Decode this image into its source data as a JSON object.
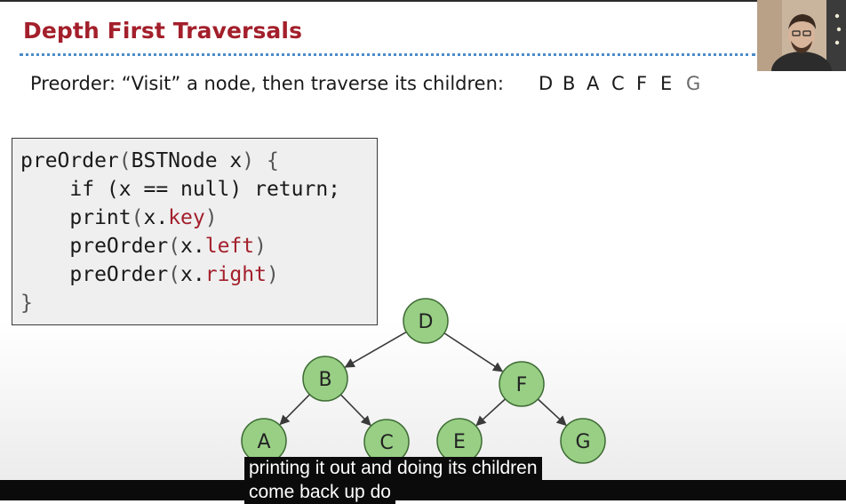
{
  "slide": {
    "title": "Depth First Traversals",
    "preorder_text": "Preorder: “Visit” a node, then traverse its children:",
    "sequence": [
      "D",
      "B",
      "A",
      "C",
      "F",
      "E",
      "G"
    ]
  },
  "code": {
    "line1": {
      "name": "preOrder",
      "open": "(",
      "arg": "BSTNode x",
      "close": ")",
      "brace": " {"
    },
    "line2": "if (x == null) return;",
    "line3": {
      "fn": "print",
      "open": "(",
      "obj": "x.",
      "field": "key",
      "close": ")"
    },
    "line4": {
      "fn": "preOrder",
      "open": "(",
      "obj": "x.",
      "field": "left",
      "close": ")"
    },
    "line5": {
      "fn": "preOrder",
      "open": "(",
      "obj": "x.",
      "field": "right",
      "close": ")"
    },
    "line6": "}"
  },
  "tree": {
    "nodes": [
      {
        "id": "D",
        "label": "D"
      },
      {
        "id": "B",
        "label": "B"
      },
      {
        "id": "F",
        "label": "F"
      },
      {
        "id": "A",
        "label": "A"
      },
      {
        "id": "C",
        "label": "C"
      },
      {
        "id": "E",
        "label": "E"
      },
      {
        "id": "G",
        "label": "G"
      }
    ],
    "edges": [
      [
        "D",
        "B"
      ],
      [
        "D",
        "F"
      ],
      [
        "B",
        "A"
      ],
      [
        "B",
        "C"
      ],
      [
        "F",
        "E"
      ],
      [
        "F",
        "G"
      ]
    ],
    "colors": {
      "node_fill": "#98cf85",
      "node_stroke": "#3d6b33",
      "edge": "#3a3a3a"
    }
  },
  "captions": {
    "line1": "printing it out and doing its children",
    "line2": "come back up do"
  },
  "colors": {
    "title": "#a31f2b",
    "rule": "#4b8cc9",
    "code_field": "#a31f2b"
  }
}
